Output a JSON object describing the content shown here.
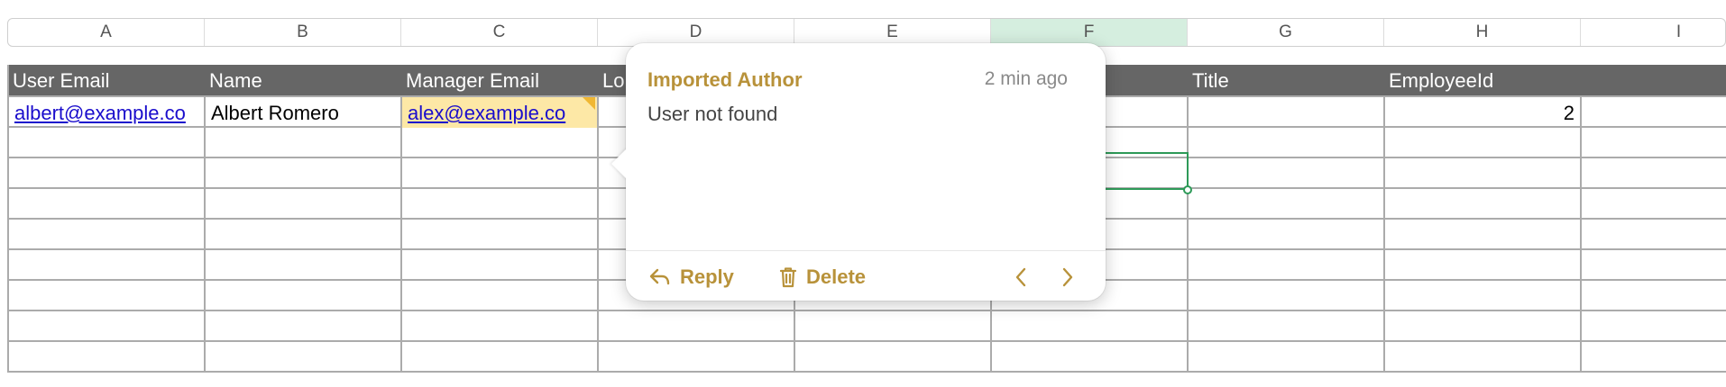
{
  "columns": [
    "A",
    "B",
    "C",
    "D",
    "E",
    "F",
    "G",
    "H",
    "I"
  ],
  "selected_column": "F",
  "header_row": [
    "User Email",
    "Name",
    "Manager Email",
    "Lo",
    "",
    "",
    "Title",
    "EmployeeId",
    ""
  ],
  "rows": [
    {
      "user_email": "albert@example.co",
      "name": "Albert Romero",
      "manager_email": "alex@example.co",
      "d": "",
      "e": "",
      "f": "",
      "title": "",
      "employee_id": "2",
      "i": ""
    }
  ],
  "comment": {
    "author": "Imported Author",
    "time": "2 min ago",
    "body": "User not found",
    "reply_label": "Reply",
    "delete_label": "Delete"
  },
  "colors": {
    "header_bg": "#666666",
    "accent": "#b8923a",
    "selection": "#2e9a58",
    "link": "#1a0dcc",
    "comment_highlight": "#fde8a6"
  }
}
